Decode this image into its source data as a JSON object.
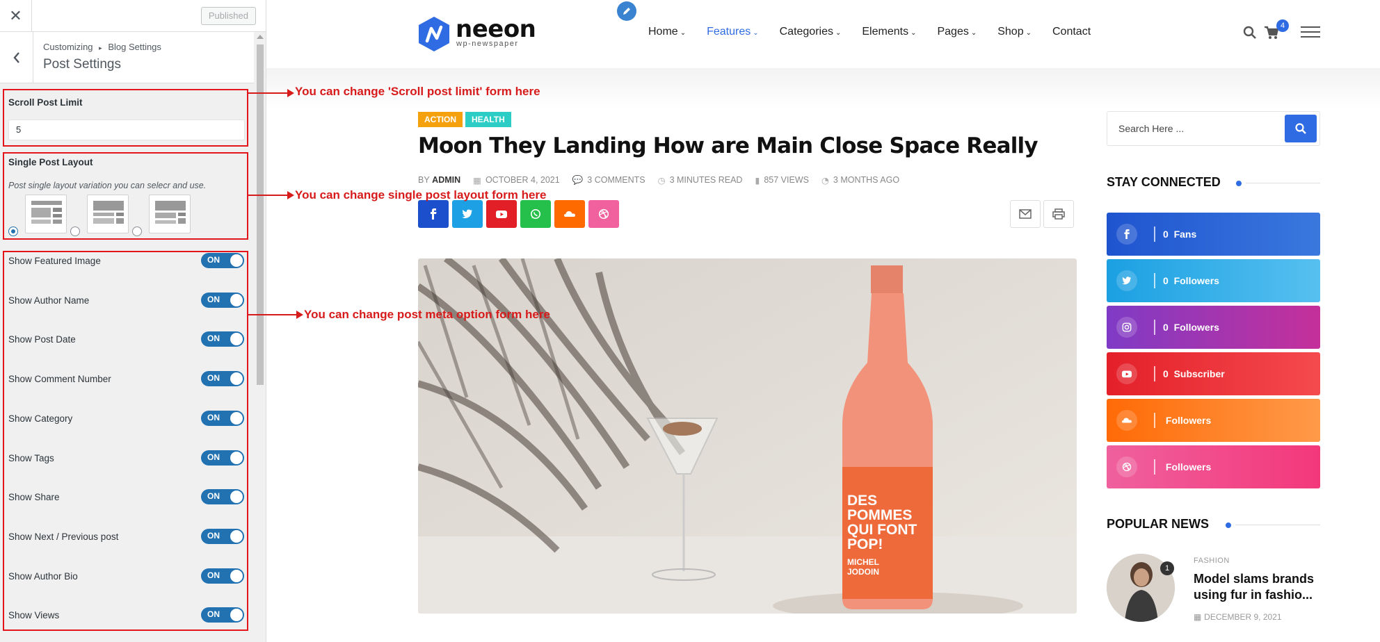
{
  "customizer": {
    "close_icon": "close-icon",
    "publish_label": "Published",
    "breadcrumb_root": "Customizing",
    "breadcrumb_sep": "▸",
    "breadcrumb_section": "Blog Settings",
    "section_title": "Post Settings",
    "scroll_limit": {
      "label": "Scroll Post Limit",
      "value": "5"
    },
    "single_layout": {
      "label": "Single Post Layout",
      "description": "Post single layout variation you can selecr and use.",
      "selected_index": 0
    },
    "toggles": [
      {
        "label": "Show Featured Image",
        "state": "ON"
      },
      {
        "label": "Show Author Name",
        "state": "ON"
      },
      {
        "label": "Show Post Date",
        "state": "ON"
      },
      {
        "label": "Show Comment Number",
        "state": "ON"
      },
      {
        "label": "Show Category",
        "state": "ON"
      },
      {
        "label": "Show Tags",
        "state": "ON"
      },
      {
        "label": "Show Share",
        "state": "ON"
      },
      {
        "label": "Show Next / Previous post",
        "state": "ON"
      },
      {
        "label": "Show Author Bio",
        "state": "ON"
      },
      {
        "label": "Show Views",
        "state": "ON"
      }
    ]
  },
  "annotations": [
    "You can change 'Scroll post limit' form here",
    "You can change single post layout form here",
    "You can change post meta option form here"
  ],
  "site": {
    "logo_name": "neeon",
    "logo_sub": "wp-newspaper",
    "nav": [
      {
        "label": "Home",
        "dropdown": true,
        "active": false
      },
      {
        "label": "Features",
        "dropdown": true,
        "active": true
      },
      {
        "label": "Categories",
        "dropdown": true,
        "active": false
      },
      {
        "label": "Elements",
        "dropdown": true,
        "active": false
      },
      {
        "label": "Pages",
        "dropdown": true,
        "active": false
      },
      {
        "label": "Shop",
        "dropdown": true,
        "active": false
      },
      {
        "label": "Contact",
        "dropdown": false,
        "active": false
      }
    ],
    "cart_count": "4",
    "accent": "#2f6be2"
  },
  "post": {
    "tags": [
      {
        "label": "ACTION",
        "color": "#f5a00d"
      },
      {
        "label": "HEALTH",
        "color": "#2ccdc4"
      }
    ],
    "title": "Moon They Landing How are Main Close Space Really",
    "by": "BY",
    "author": "ADMIN",
    "date": "OCTOBER 4, 2021",
    "comments": "3 COMMENTS",
    "read_time": "3 MINUTES READ",
    "views": "857 VIEWS",
    "ago": "3 MONTHS AGO",
    "share": [
      {
        "icon": "facebook-icon",
        "color": "#1b4fcb"
      },
      {
        "icon": "twitter-icon",
        "color": "#1da1e4"
      },
      {
        "icon": "youtube-icon",
        "color": "#e21f26"
      },
      {
        "icon": "whatsapp-icon",
        "color": "#25c04b"
      },
      {
        "icon": "soundcloud-icon",
        "color": "#ff6a00"
      },
      {
        "icon": "dribbble-icon",
        "color": "#f0619e"
      }
    ],
    "bottle_label": "DES POMMES QUI FONT POP!",
    "bottle_maker": "MICHEL JODOIN"
  },
  "widgets": {
    "search_placeholder": "Search Here ...",
    "stay_connected": "STAY CONNECTED",
    "social": [
      {
        "icon": "facebook-icon",
        "count": "0",
        "label": "Fans",
        "from": "#1f54cf",
        "to": "#3a78de"
      },
      {
        "icon": "twitter-icon",
        "count": "0",
        "label": "Followers",
        "from": "#1ba0e2",
        "to": "#57c0f0"
      },
      {
        "icon": "instagram-icon",
        "count": "0",
        "label": "Followers",
        "from": "#7f3bc6",
        "to": "#c5309a"
      },
      {
        "icon": "youtube-icon",
        "count": "0",
        "label": "Subscriber",
        "from": "#e4202a",
        "to": "#f44a4e"
      },
      {
        "icon": "soundcloud-icon",
        "count": "",
        "label": "Followers",
        "from": "#ff6a06",
        "to": "#ff9a4a"
      },
      {
        "icon": "dribbble-icon",
        "count": "",
        "label": "Followers",
        "from": "#f0609e",
        "to": "#f3387a"
      }
    ],
    "popular_news": "POPULAR NEWS",
    "popular": {
      "rank": "1",
      "category": "FASHION",
      "title": "Model slams brands using fur in fashio...",
      "date": "DECEMBER 9, 2021"
    }
  }
}
